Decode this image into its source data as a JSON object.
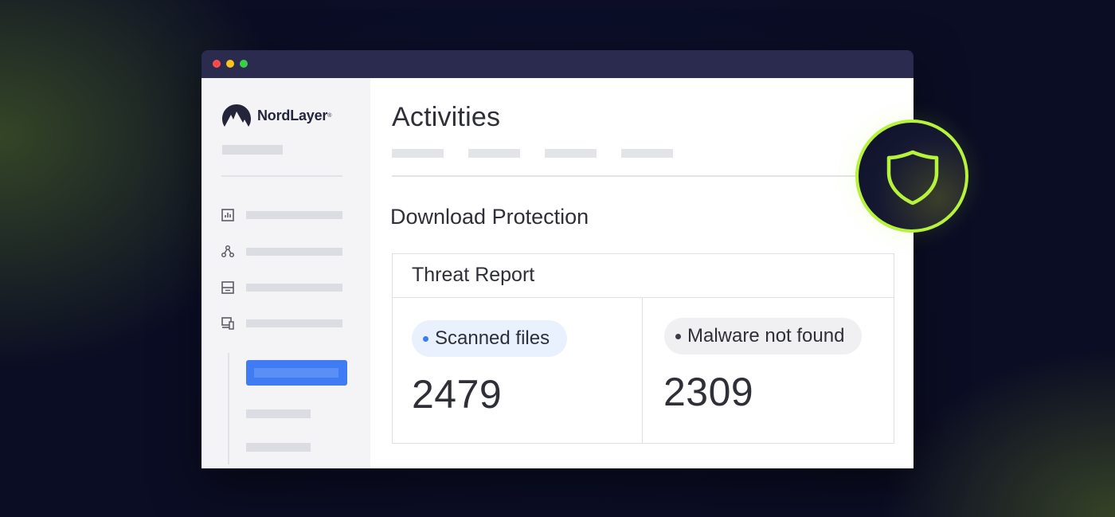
{
  "brand": {
    "name": "NordLayer",
    "reg_mark": "®"
  },
  "window_controls": [
    "close",
    "minimize",
    "maximize"
  ],
  "sidebar": {
    "nav_icons": [
      "chart-icon",
      "network-icon",
      "server-icon",
      "devices-icon"
    ]
  },
  "main": {
    "page_title": "Activities",
    "section_title": "Download Protection",
    "report": {
      "title": "Threat Report",
      "stats": [
        {
          "label": "Scanned files",
          "value": "2479",
          "accent": "#3f7cf4"
        },
        {
          "label": "Malware not found",
          "value": "2309",
          "accent": "#3a3b45"
        }
      ]
    }
  },
  "badge": {
    "icon": "shield-icon",
    "color": "#b7f23c"
  },
  "colors": {
    "accent_blue": "#3f7cf4",
    "accent_green": "#b7f23c",
    "titlebar": "#2a2b4f"
  }
}
